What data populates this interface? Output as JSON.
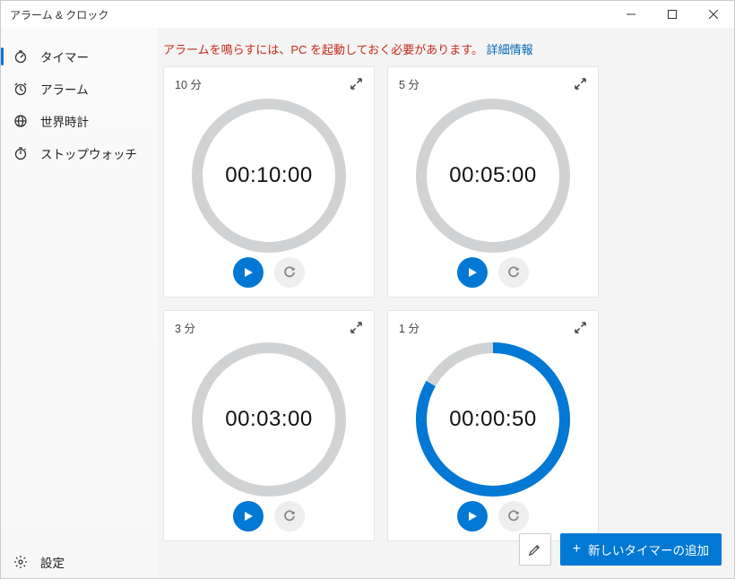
{
  "window": {
    "title": "アラーム & クロック"
  },
  "sidebar": {
    "items": [
      {
        "label": "タイマー"
      },
      {
        "label": "アラーム"
      },
      {
        "label": "世界時計"
      },
      {
        "label": "ストップウォッチ"
      }
    ],
    "settings": "設定"
  },
  "notice": {
    "text": "アラームを鳴らすには、PC を起動しておく必要があります。 ",
    "link": "詳細情報"
  },
  "timers": [
    {
      "title": "10 分",
      "time": "00:10:00",
      "progress": 0
    },
    {
      "title": "5 分",
      "time": "00:05:00",
      "progress": 0
    },
    {
      "title": "3 分",
      "time": "00:03:00",
      "progress": 0
    },
    {
      "title": "1 分",
      "time": "00:00:50",
      "progress": 0.833
    }
  ],
  "bottombar": {
    "add_label": "新しいタイマーの追加"
  },
  "colors": {
    "accent": "#0078d4",
    "ring_bg": "#d0d2d4"
  }
}
